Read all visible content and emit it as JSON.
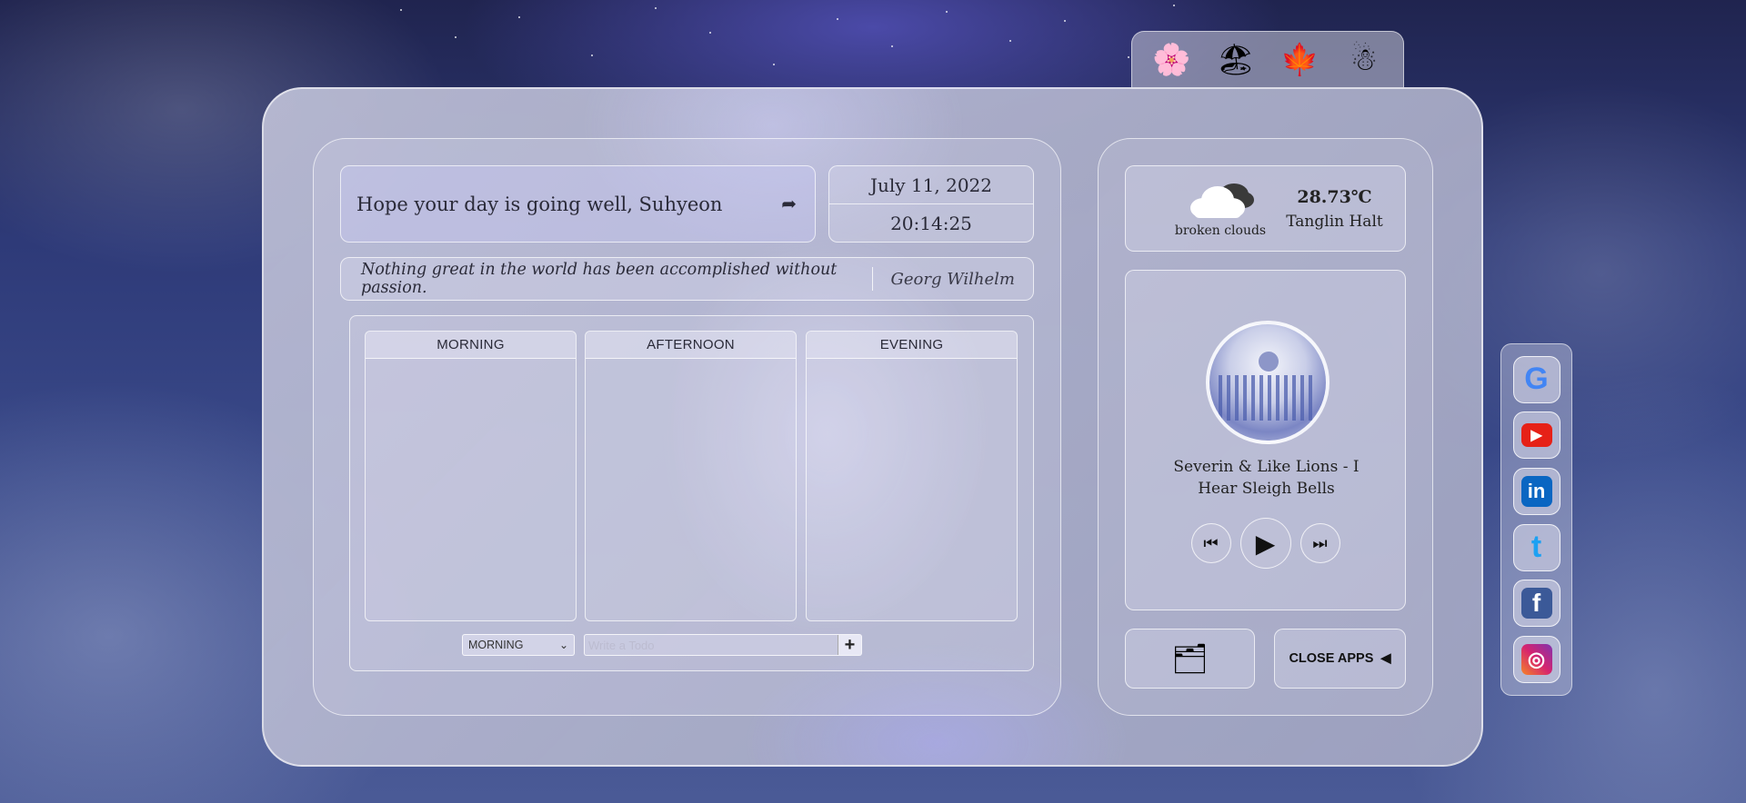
{
  "seasons": [
    {
      "name": "spring",
      "icon": "cherry-blossom-icon"
    },
    {
      "name": "summer",
      "icon": "beach-umbrella-icon"
    },
    {
      "name": "autumn",
      "icon": "maple-leaf-icon"
    },
    {
      "name": "winter",
      "icon": "snowman-icon"
    }
  ],
  "greeting": {
    "text": "Hope your day is going well, Suhyeon",
    "logout_icon": "logout-icon"
  },
  "clock": {
    "date": "July 11, 2022",
    "time": "20:14:25"
  },
  "quote": {
    "text": "Nothing great in the world has been accomplished without passion.",
    "author": "Georg Wilhelm"
  },
  "todo": {
    "columns": [
      "MORNING",
      "AFTERNOON",
      "EVENING"
    ],
    "select_value": "MORNING",
    "input_placeholder": "Write a Todo",
    "add_label": "+"
  },
  "weather": {
    "description": "broken clouds",
    "temp": "28.73℃",
    "city": "Tanglin Halt",
    "icon": "cloud-icon"
  },
  "player": {
    "song": "Severin & Like Lions - I Hear Sleigh Bells",
    "prev": "⏮",
    "play": "▶",
    "next": "⏭"
  },
  "apps": {
    "close_label": "CLOSE APPS",
    "close_icon": "caret-left-icon",
    "toggle_icon": "apps-folder-icon"
  },
  "app_links": [
    {
      "name": "google",
      "glyph": "G",
      "color": "#4285F4"
    },
    {
      "name": "youtube",
      "glyph": "▶",
      "color": "#E62117"
    },
    {
      "name": "linkedin",
      "glyph": "in",
      "color": "#0A66C2"
    },
    {
      "name": "twitter",
      "glyph": "t",
      "color": "#1DA1F2"
    },
    {
      "name": "facebook",
      "glyph": "f",
      "color": "#3B5998"
    },
    {
      "name": "instagram",
      "glyph": "◎",
      "color": "#D6246E"
    }
  ]
}
